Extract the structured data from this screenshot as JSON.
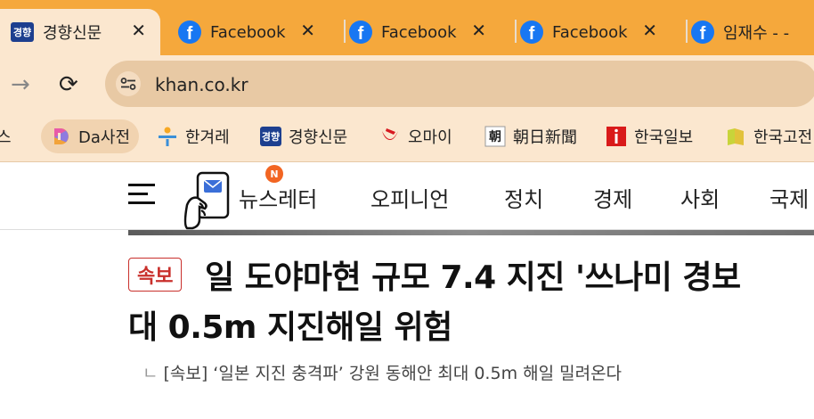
{
  "tabs": [
    {
      "title": "경향신문",
      "icon": "khan-logo-icon",
      "active": true
    },
    {
      "title": "Facebook",
      "icon": "facebook-icon",
      "active": false
    },
    {
      "title": "Facebook",
      "icon": "facebook-icon",
      "active": false
    },
    {
      "title": "Facebook",
      "icon": "facebook-icon",
      "active": false
    },
    {
      "title": "임재수 - -",
      "icon": "facebook-icon",
      "active": false
    }
  ],
  "tab_close_glyph": "✕",
  "toolbar": {
    "forward_glyph": "→",
    "reload_glyph": "⟳",
    "url": "khan.co.kr"
  },
  "bookmarks": [
    {
      "label": "스",
      "icon": "none"
    },
    {
      "label": "Da사전",
      "icon": "da-dictionary-icon"
    },
    {
      "label": "한겨레",
      "icon": "hani-icon"
    },
    {
      "label": "경향신문",
      "icon": "khan-logo-icon"
    },
    {
      "label": "오마이",
      "icon": "ohmynews-icon"
    },
    {
      "label": "朝日新聞",
      "icon": "asahi-icon"
    },
    {
      "label": "한국일보",
      "icon": "hankook-icon"
    },
    {
      "label": "한국고전",
      "icon": "classics-icon"
    }
  ],
  "khan_logo_text": "경향",
  "nav": {
    "newsletter_badge": "N",
    "items": [
      "뉴스레터",
      "오피니언",
      "정치",
      "경제",
      "사회",
      "국제"
    ]
  },
  "article": {
    "badge": "속보",
    "headline_line1": "일 도야마현 규모 7.4 지진 '쓰나미 경보",
    "headline_line2": "대 0.5m 지진해일 위험",
    "related_corner": "ㄴ",
    "related": "[속보] ‘일본 지진 충격파’ 강원 동해안 최대 0.5m 해일 밀려온다"
  },
  "colors": {
    "tabstrip": "#f5a83c",
    "toolbar": "#fbe7cf",
    "facebook": "#1877f2",
    "breaking_red": "#c9302c"
  }
}
